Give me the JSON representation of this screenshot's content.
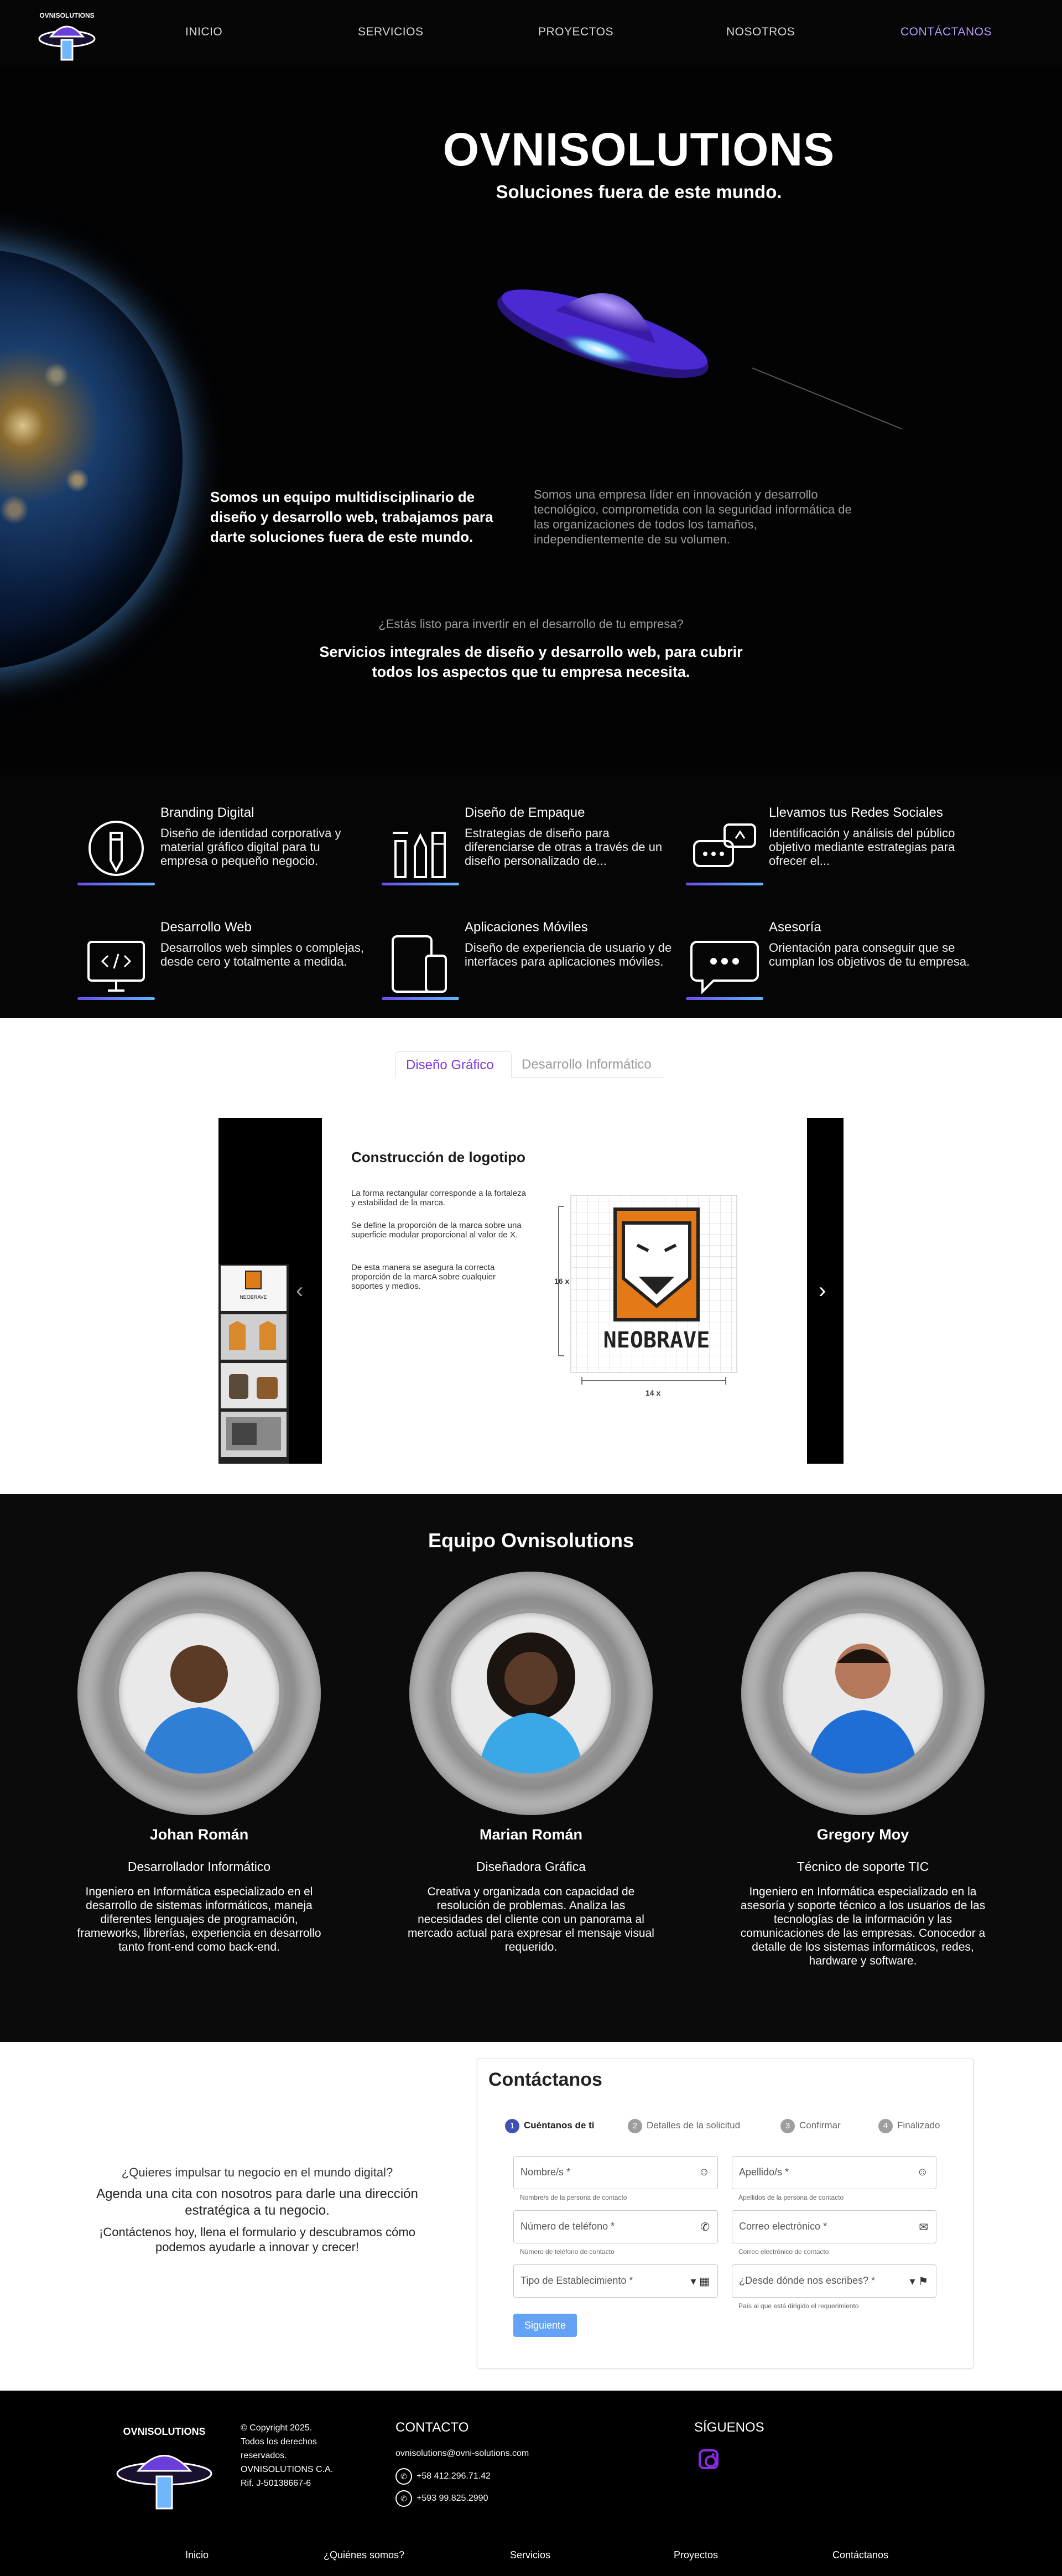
{
  "nav": {
    "items": [
      "INICIO",
      "SERVICIOS",
      "PROYECTOS",
      "NOSOTROS",
      "CONTÁCTANOS"
    ],
    "active_color": "#b79cff"
  },
  "logo": {
    "text": "OVNISOLUTIONS"
  },
  "hero": {
    "title": "OVNISOLUTIONS",
    "subtitle": "Soluciones fuera de este mundo.",
    "intro_left": "Somos un equipo multidisciplinario de diseño y desarrollo web, trabajamos para darte soluciones fuera de este mundo.",
    "intro_right": "Somos una empresa líder en innovación y desarrollo tecnológico, comprometida con la seguridad informática de las organizaciones de todos los tamaños, independientemente de su volumen.",
    "question": "¿Estás listo para invertir en el desarrollo de tu empresa?",
    "pitch": "Servicios integrales de diseño y desarrollo web, para cubrir todos los aspectos que tu empresa necesita."
  },
  "services": [
    {
      "title": "Branding Digital",
      "text": "Diseño de identidad corporativa y material gráfico digital para tu empresa o pequeño negocio.",
      "icon": "pencil-icon"
    },
    {
      "title": "Diseño de Empaque",
      "text": "Estrategias de diseño para diferenciarse de otras a través de un diseño personalizado de...",
      "icon": "package-tools-icon"
    },
    {
      "title": "Llevamos tus Redes Sociales",
      "text": "Identificación y análisis del público objetivo mediante estrategias para ofrecer el...",
      "icon": "social-chat-icon"
    },
    {
      "title": "Desarrollo Web",
      "text": "Desarrollos web simples o complejas, desde cero y totalmente a medida.",
      "icon": "monitor-code-icon"
    },
    {
      "title": "Aplicaciones Móviles",
      "text": "Diseño de experiencia de usuario y de interfaces para aplicaciones móviles.",
      "icon": "devices-icon"
    },
    {
      "title": "Asesoría",
      "text": "Orientación para conseguir que se cumplan los objetivos de tu empresa.",
      "icon": "chat-bubble-icon"
    }
  ],
  "portfolio": {
    "tabs": [
      "Diseño Gráfico",
      "Desarrollo Informático"
    ],
    "slide": {
      "title": "Construcción de logotipo",
      "p1": "La forma rectangular corresponde a la fortaleza y estabilidad de la marca.",
      "p2": "Se define la proporción de la marca sobre una superficie modular proporcional al valor de X.",
      "p3": "De esta manera se asegura la correcta proporción de la marcA sobre cualquier soportes y medios.",
      "height_label": "16 x",
      "width_label": "14 x",
      "brand": "NEOBRAVE"
    }
  },
  "team": {
    "title": "Equipo Ovnisolutions",
    "members": [
      {
        "name": "Johan Román",
        "role": "Desarrollador Informático",
        "bio": "Ingeniero en Informática especializado en el desarrollo de sistemas informáticos, maneja diferentes lenguajes de programación, frameworks, librerías, experiencia en desarrollo tanto front-end como back-end."
      },
      {
        "name": "Marian Román",
        "role": "Diseñadora Gráfica",
        "bio": "Creativa y organizada con capacidad de resolución de problemas. Analiza las necesidades del cliente con un panorama al mercado actual para expresar el mensaje visual requerido."
      },
      {
        "name": "Gregory Moy",
        "role": "Técnico de soporte TIC",
        "bio": "Ingeniero en Informática especializado en la asesoría y soporte técnico a los usuarios de las tecnologías de la información y las comunicaciones de las empresas. Conocedor a detalle de los sistemas informáticos, redes, hardware y software."
      }
    ]
  },
  "contact": {
    "left_q": "¿Quieres impulsar tu negocio en el mundo digital?",
    "left_b": "Agenda una cita con nosotros para darle una dirección estratégica a tu negocio.",
    "left_c": "¡Contáctenos hoy, llena el formulario y descubramos cómo podemos ayudarle a innovar y crecer!",
    "form_title": "Contáctanos",
    "steps": [
      {
        "n": "1",
        "label": "Cuéntanos de ti"
      },
      {
        "n": "2",
        "label": "Detalles de la solicitud"
      },
      {
        "n": "3",
        "label": "Confirmar"
      },
      {
        "n": "4",
        "label": "Finalizado"
      }
    ],
    "fields": [
      {
        "placeholder": "Nombre/s *",
        "hint": "Nombre/s de la persona de contacto",
        "icon": "face-icon"
      },
      {
        "placeholder": "Apellido/s *",
        "hint": "Apellidos de la persona de contacto",
        "icon": "face-icon"
      },
      {
        "placeholder": "Número de teléfono *",
        "hint": "Número de teléfono de contacto",
        "icon": "phone-icon"
      },
      {
        "placeholder": "Correo electrónico *",
        "hint": "Correo electrónico de contacto",
        "icon": "mail-icon"
      },
      {
        "placeholder": "Tipo de Establecimiento *",
        "hint": "",
        "icon": "business-icon"
      },
      {
        "placeholder": "¿Desde dónde nos escribes? *",
        "hint": "País al que está dirigido el requerimiento",
        "icon": "flag-icon"
      }
    ],
    "submit": "Siguiente"
  },
  "footer": {
    "copy_lines": [
      "© Copyright 2025.",
      "Todos los derechos",
      "reservados.",
      "OVNISOLUTIONS C.A.",
      "Rif. J-50138667-6"
    ],
    "contact_heading": "CONTACTO",
    "email": "ovnisolutions@ovni-solutions.com",
    "phones": [
      "+58 412.296.71.42",
      "+593 99.825.2990"
    ],
    "follow_heading": "SÍGUENOS",
    "links": [
      "Inicio",
      "¿Quiénes somos?",
      "Servicios",
      "Proyectos",
      "Contáctanos"
    ]
  }
}
